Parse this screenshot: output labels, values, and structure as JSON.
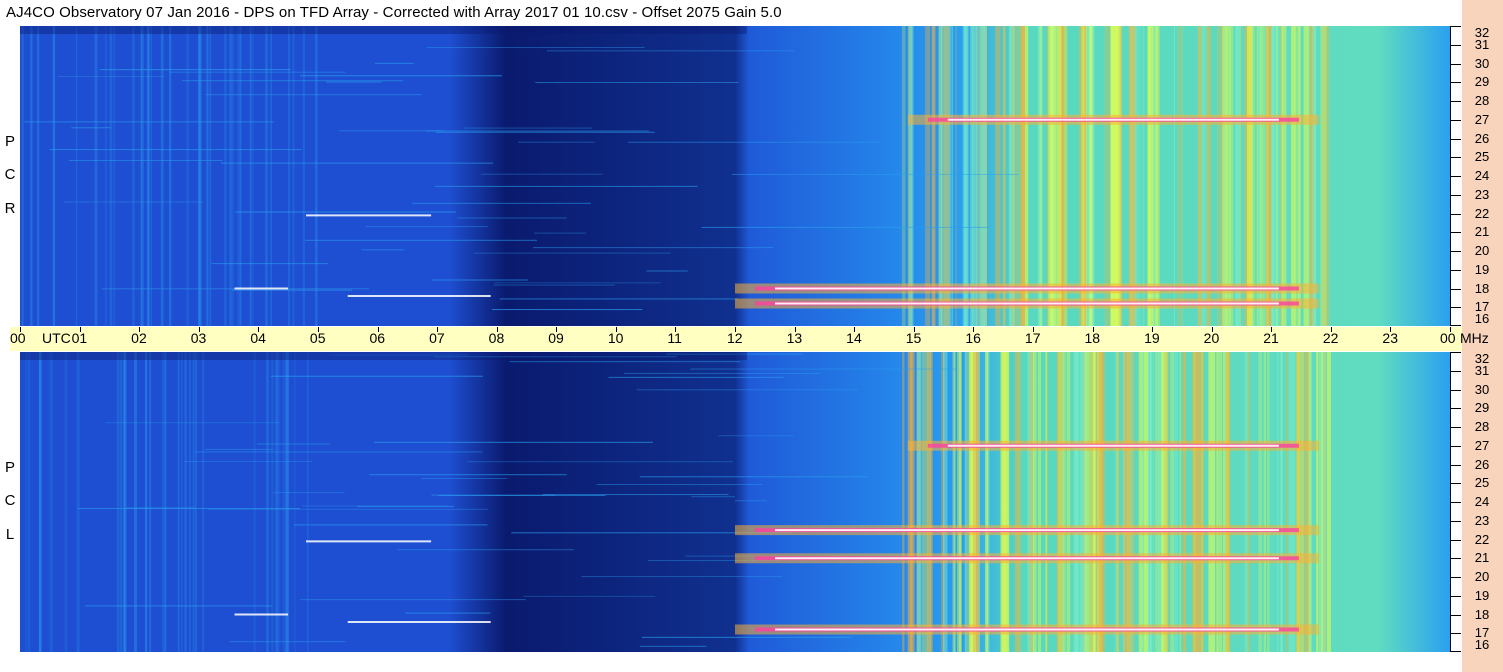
{
  "title": "AJ4CO Observatory  07 Jan 2016  -  DPS on TFD Array  -  Corrected with Array 2017 01 10.csv  -  Offset 2075  Gain 5.0",
  "chart_data": {
    "type": "heatmap",
    "title": "AJ4CO Observatory  07 Jan 2016  -  DPS on TFD Array  -  Corrected with Array 2017 01 10.csv  -  Offset 2075  Gain 5.0",
    "x_axis": {
      "unit_label": "UTC",
      "range": [
        0,
        24
      ],
      "ticks": [
        "00",
        "01",
        "02",
        "03",
        "04",
        "05",
        "06",
        "07",
        "08",
        "09",
        "10",
        "11",
        "12",
        "13",
        "14",
        "15",
        "16",
        "17",
        "18",
        "19",
        "20",
        "21",
        "22",
        "23",
        "00"
      ]
    },
    "y_axis": {
      "unit_label": "MHz",
      "range": [
        16,
        32
      ],
      "ticks": [
        "16",
        "17",
        "18",
        "19",
        "20",
        "21",
        "22",
        "23",
        "24",
        "25",
        "26",
        "27",
        "28",
        "29",
        "30",
        "31",
        "32"
      ]
    },
    "panels": [
      {
        "name": "RCP",
        "label_chars": [
          "P",
          "C",
          "R"
        ],
        "bands_mhz": [
          27.0,
          18.0,
          17.2
        ],
        "quiet_until_utc": 12.2
      },
      {
        "name": "LCP",
        "label_chars": [
          "P",
          "C",
          "L"
        ],
        "bands_mhz": [
          27.0,
          21.0,
          22.5,
          17.2
        ],
        "quiet_until_utc": 12.2
      }
    ],
    "grid": false,
    "colormap": [
      "#0a1a6e",
      "#1e4fd2",
      "#2aa0f0",
      "#7cf0c8",
      "#e8ff4a",
      "#ffb030",
      "#ff40a0",
      "#ffffff"
    ]
  }
}
